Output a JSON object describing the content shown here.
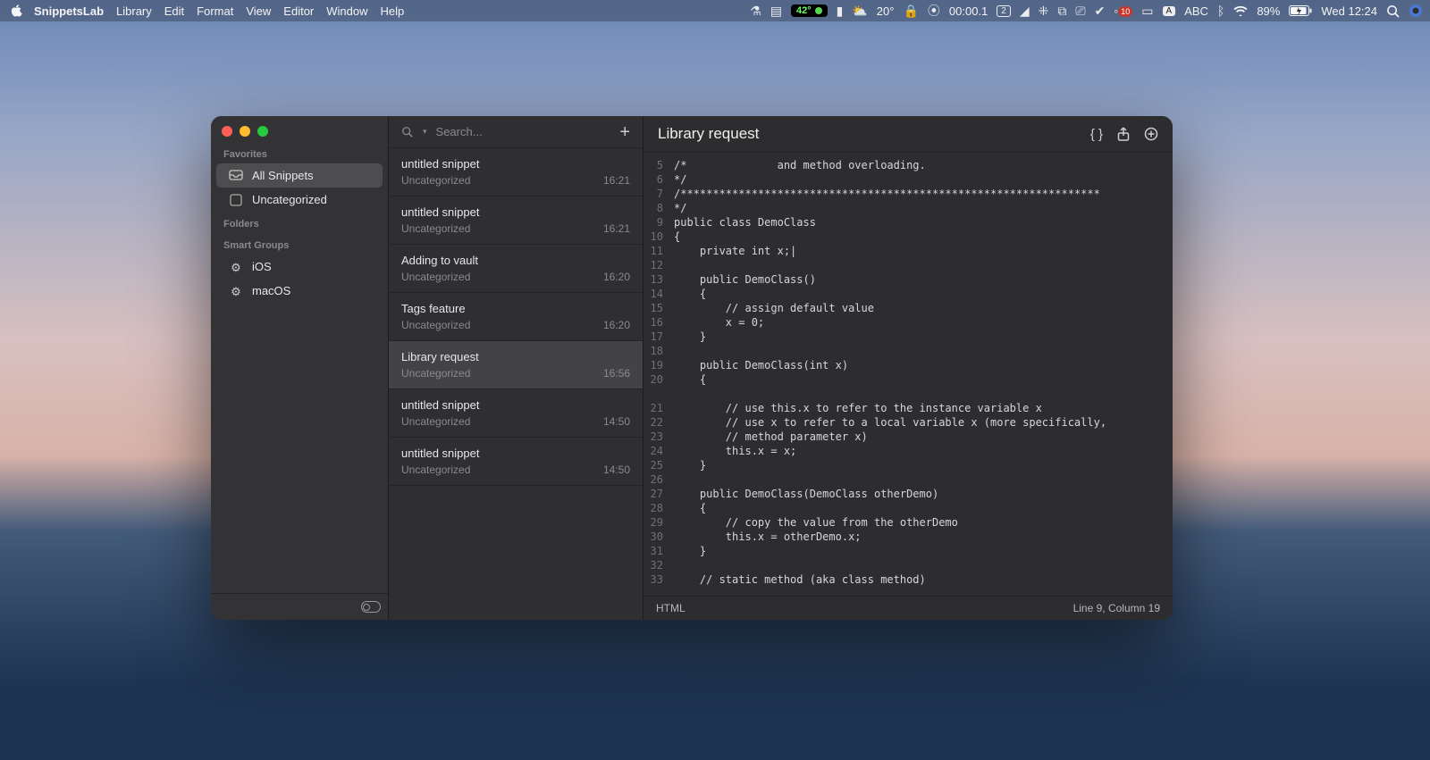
{
  "menubar": {
    "app_name": "SnippetsLab",
    "items": [
      "Library",
      "Edit",
      "Format",
      "View",
      "Editor",
      "Window",
      "Help"
    ],
    "temp_badge": "42°",
    "weather": "20°",
    "timer": "00:00.1",
    "window_count": "2",
    "notif_count": "10",
    "input_lang": "ABC",
    "battery": "89%",
    "clock": "Wed 12:24"
  },
  "sidebar": {
    "sections": {
      "favorites_label": "Favorites",
      "folders_label": "Folders",
      "smart_label": "Smart Groups"
    },
    "favorites": [
      {
        "label": "All Snippets",
        "selected": true
      },
      {
        "label": "Uncategorized",
        "selected": false
      }
    ],
    "smart": [
      {
        "label": "iOS"
      },
      {
        "label": "macOS"
      }
    ]
  },
  "search": {
    "placeholder": "Search..."
  },
  "snippets": [
    {
      "title": "untitled snippet",
      "cat": "Uncategorized",
      "time": "16:21",
      "sel": false
    },
    {
      "title": "untitled snippet",
      "cat": "Uncategorized",
      "time": "16:21",
      "sel": false
    },
    {
      "title": "Adding to vault",
      "cat": "Uncategorized",
      "time": "16:20",
      "sel": false
    },
    {
      "title": "Tags feature",
      "cat": "Uncategorized",
      "time": "16:20",
      "sel": false
    },
    {
      "title": "Library request",
      "cat": "Uncategorized",
      "time": "16:56",
      "sel": true
    },
    {
      "title": "untitled snippet",
      "cat": "Uncategorized",
      "time": "14:50",
      "sel": false
    },
    {
      "title": "untitled snippet",
      "cat": "Uncategorized",
      "time": "14:50",
      "sel": false
    }
  ],
  "editor": {
    "title": "Library request",
    "lang": "HTML",
    "status": "Line 9, Column 19",
    "gutter_start": 5,
    "gutter_end": 31,
    "code": "/*              and method overloading.\n*/\n/*****************************************************************\n*/\npublic class DemoClass\n{\n    private int x;|\n\n    public DemoClass()\n    {\n        // assign default value\n        x = 0;\n    }\n\n    public DemoClass(int x)\n    {\n        // use this.x to refer to the instance variable x\n        // use x to refer to a local variable x (more specifically,\n        // method parameter x)\n        this.x = x;\n    }\n\n    public DemoClass(DemoClass otherDemo)\n    {\n        // copy the value from the otherDemo\n        this.x = otherDemo.x;\n    }\n\n    // static method (aka class method)"
  }
}
